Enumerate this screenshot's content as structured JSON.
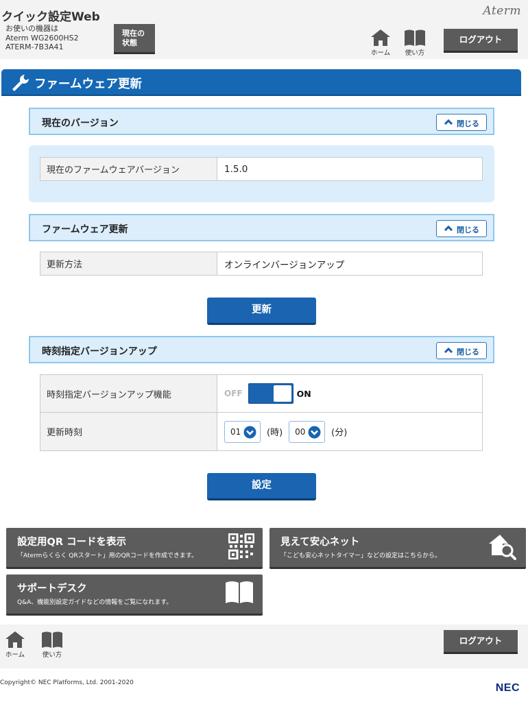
{
  "header": {
    "app_title": "クイック設定Web",
    "device_label": "お使いの機器は",
    "device_model": "Aterm WG2600HS2",
    "device_id": "ATERM-7B3A41",
    "status_button": "現在の\n状態",
    "brand": "Aterm",
    "home_label": "ホーム",
    "help_label": "使い方",
    "logout_label": "ログアウト"
  },
  "page_title": "ファームウェア更新",
  "sections": {
    "current_version": {
      "title": "現在のバージョン",
      "close_label": "閉じる",
      "row_label": "現在のファームウェアバージョン",
      "row_value": "1.5.0"
    },
    "firmware_update": {
      "title": "ファームウェア更新",
      "close_label": "閉じる",
      "row_label": "更新方法",
      "row_value": "オンラインバージョンアップ",
      "button_label": "更新"
    },
    "scheduled_update": {
      "title": "時刻指定バージョンアップ",
      "close_label": "閉じる",
      "feature_label": "時刻指定バージョンアップ機能",
      "toggle_off": "OFF",
      "toggle_on": "ON",
      "toggle_state": "ON",
      "time_label": "更新時刻",
      "hour_value": "01",
      "hour_unit": "(時)",
      "minute_value": "00",
      "minute_unit": "(分)",
      "button_label": "設定"
    }
  },
  "cards": [
    {
      "title": "設定用QR コードを表示",
      "desc": "「Atermらくらく QRスタート」用のQRコードを作成できます。",
      "icon": "qr-code-icon"
    },
    {
      "title": "見えて安心ネット",
      "desc": "「こども安心ネットタイマー」などの設定はこちらから。",
      "icon": "house-search-icon"
    },
    {
      "title": "サポートデスク",
      "desc": "Q&A、機能別設定ガイドなどの情報をご覧になれます。",
      "icon": "book-icon"
    }
  ],
  "footer": {
    "home_label": "ホーム",
    "help_label": "使い方",
    "logout_label": "ログアウト",
    "copyright": "Copyright© NEC Platforms, Ltd. 2001-2020",
    "logo": "NEC"
  },
  "colors": {
    "primary_blue": "#1a64b1",
    "title_bar": "#1668b4",
    "section_bg": "#dceefc",
    "dark_button": "#5b5b5b"
  }
}
